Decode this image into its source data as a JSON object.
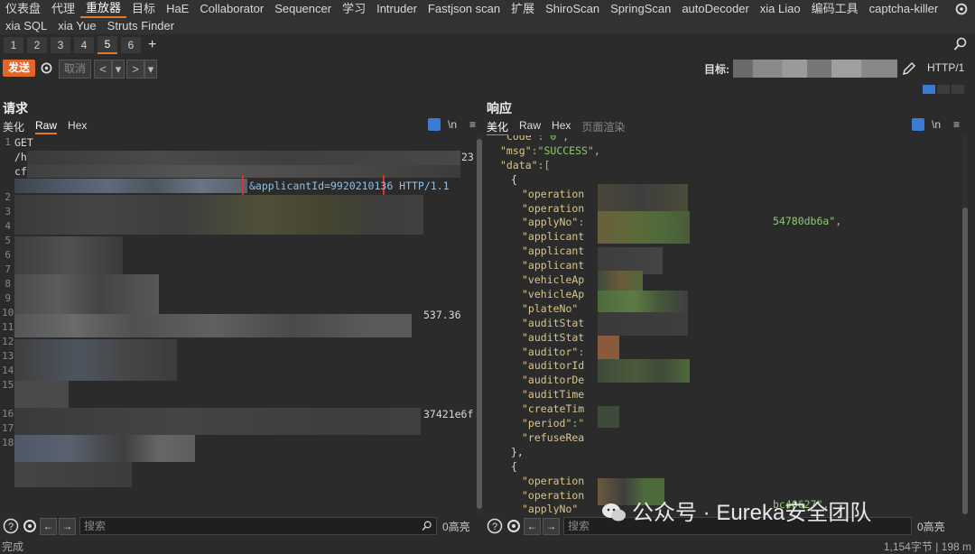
{
  "top_tabs_line1": [
    "仪表盘",
    "代理",
    "重放器",
    "目标",
    "HaE",
    "Collaborator",
    "Sequencer",
    "学习",
    "Intruder",
    "Fastjson scan",
    "扩展",
    "ShiroScan",
    "SpringScan",
    "autoDecoder",
    "xia Liao",
    "编码工具",
    "captcha-killer"
  ],
  "top_tabs_line2": [
    "xia SQL",
    "xia Yue",
    "Struts Finder"
  ],
  "active_top_tab": "重放器",
  "num_tabs": [
    "1",
    "2",
    "3",
    "4",
    "5",
    "6"
  ],
  "active_num_tab": "5",
  "icons": {
    "plus": "plus-icon",
    "settings": "gear-icon",
    "search": "search-icon",
    "edit": "pencil-icon",
    "help": "help-icon",
    "back": "arrow-left-icon",
    "forward": "arrow-right-icon",
    "wrap": "wrap-icon"
  },
  "toolbar": {
    "send_label": "发送",
    "cancel_label": "取消",
    "back": "<",
    "forward": ">",
    "target_label": "目标:",
    "protocol": "HTTP/1"
  },
  "request": {
    "title": "请求",
    "tabs": [
      "美化",
      "Raw",
      "Hex"
    ],
    "active_tab": "Raw",
    "newline_label": "\\n",
    "menu_label": "≡",
    "lines": [
      {
        "no": "1",
        "text": "GET"
      },
      {
        "no": "",
        "text": "/h"
      },
      {
        "no": "",
        "text": "cf"
      },
      {
        "no": "",
        "text": "&applicantId=9920210136 HTTP/1.1"
      }
    ],
    "visible_line_numbers": [
      "1",
      "2",
      "3",
      "4",
      "5",
      "6",
      "7",
      "8",
      "9",
      "10",
      "11",
      "12",
      "13",
      "14",
      "15",
      "16",
      "17",
      "18"
    ],
    "tail_23": "23",
    "frag_537": "537.36",
    "frag_hash": "37421e6f",
    "search_placeholder": "搜索",
    "highlight_count": "0高亮"
  },
  "response": {
    "title": "响应",
    "tabs": [
      "美化",
      "Raw",
      "Hex",
      "页面渲染"
    ],
    "active_tab": "美化",
    "newline_label": "\\n",
    "menu_label": "≡",
    "json_lines": [
      {
        "indent": 1,
        "key": "\"code\"",
        "sep": ":\"0\","
      },
      {
        "indent": 1,
        "key": "\"msg\"",
        "sep": ":\"SUCCESS\","
      },
      {
        "indent": 1,
        "key": "\"data\"",
        "sep": ":["
      },
      {
        "indent": 2,
        "key": "",
        "sep": "{"
      },
      {
        "indent": 3,
        "key": "\"operation",
        "sep": ""
      },
      {
        "indent": 3,
        "key": "\"operation",
        "sep": ""
      },
      {
        "indent": 3,
        "key": "\"applyNo\"",
        "sep": ":",
        "tail": "54780db6a\","
      },
      {
        "indent": 3,
        "key": "\"applicant",
        "sep": ""
      },
      {
        "indent": 3,
        "key": "\"applicant",
        "sep": ""
      },
      {
        "indent": 3,
        "key": "\"applicant",
        "sep": ""
      },
      {
        "indent": 3,
        "key": "\"vehicleAp",
        "sep": ""
      },
      {
        "indent": 3,
        "key": "\"vehicleAp",
        "sep": ""
      },
      {
        "indent": 3,
        "key": "\"plateNo\"",
        "sep": ""
      },
      {
        "indent": 3,
        "key": "\"auditStat",
        "sep": ""
      },
      {
        "indent": 3,
        "key": "\"auditStat",
        "sep": ""
      },
      {
        "indent": 3,
        "key": "\"auditor\"",
        "sep": ":"
      },
      {
        "indent": 3,
        "key": "\"auditorId",
        "sep": ""
      },
      {
        "indent": 3,
        "key": "\"auditorDe",
        "sep": ""
      },
      {
        "indent": 3,
        "key": "\"auditTime",
        "sep": ""
      },
      {
        "indent": 3,
        "key": "\"createTim",
        "sep": ""
      },
      {
        "indent": 3,
        "key": "\"period\"",
        "sep": ":\""
      },
      {
        "indent": 3,
        "key": "\"refuseRea",
        "sep": ""
      },
      {
        "indent": 2,
        "key": "",
        "sep": "},"
      },
      {
        "indent": 2,
        "key": "",
        "sep": "{"
      },
      {
        "indent": 3,
        "key": "\"operation",
        "sep": ""
      },
      {
        "indent": 3,
        "key": "\"operation",
        "sep": ""
      },
      {
        "indent": 3,
        "key": "\"applyNo\"",
        "sep": "",
        "tail": "bc40627\","
      }
    ],
    "search_placeholder": "搜索",
    "highlight_count": "0高亮"
  },
  "watermark": "公众号 · Eureka安全团队",
  "status": {
    "left": "完成",
    "right": "1,154字节 | 198 m"
  }
}
